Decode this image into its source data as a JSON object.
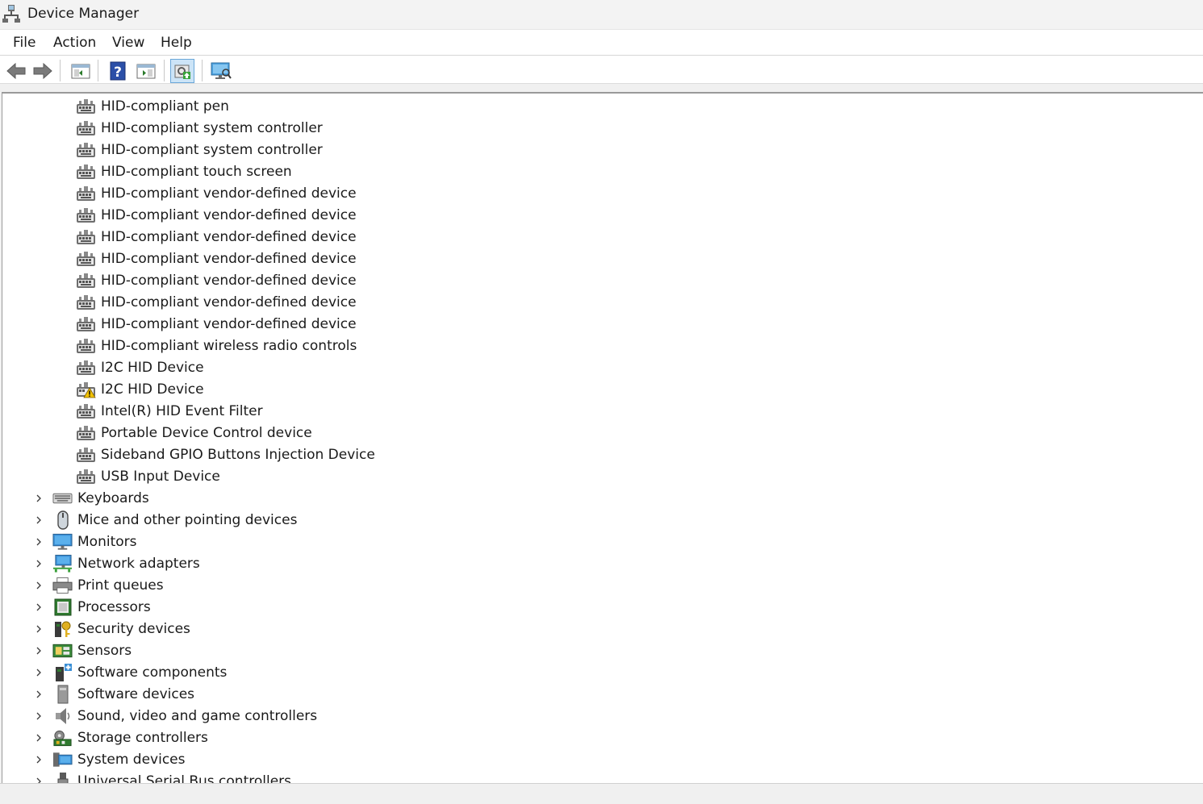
{
  "window": {
    "title": "Device Manager",
    "icon": "device-manager-icon"
  },
  "menu": [
    {
      "label": "File"
    },
    {
      "label": "Action"
    },
    {
      "label": "View"
    },
    {
      "label": "Help"
    }
  ],
  "toolbar": [
    {
      "icon": "back-arrow-icon"
    },
    {
      "icon": "forward-arrow-icon"
    },
    {
      "icon": "show-hide-console-tree-icon"
    },
    {
      "icon": "help-icon"
    },
    {
      "icon": "action-pane-icon"
    },
    {
      "icon": "update-driver-icon"
    },
    {
      "icon": "scan-hardware-changes-icon"
    }
  ],
  "hid_children": [
    {
      "label": "HID-compliant pen",
      "icon": "hid-device-icon"
    },
    {
      "label": "HID-compliant system controller",
      "icon": "hid-device-icon"
    },
    {
      "label": "HID-compliant system controller",
      "icon": "hid-device-icon"
    },
    {
      "label": "HID-compliant touch screen",
      "icon": "hid-device-icon"
    },
    {
      "label": "HID-compliant vendor-defined device",
      "icon": "hid-device-icon"
    },
    {
      "label": "HID-compliant vendor-defined device",
      "icon": "hid-device-icon"
    },
    {
      "label": "HID-compliant vendor-defined device",
      "icon": "hid-device-icon"
    },
    {
      "label": "HID-compliant vendor-defined device",
      "icon": "hid-device-icon"
    },
    {
      "label": "HID-compliant vendor-defined device",
      "icon": "hid-device-icon"
    },
    {
      "label": "HID-compliant vendor-defined device",
      "icon": "hid-device-icon"
    },
    {
      "label": "HID-compliant vendor-defined device",
      "icon": "hid-device-icon"
    },
    {
      "label": "HID-compliant wireless radio controls",
      "icon": "hid-device-icon"
    },
    {
      "label": "I2C HID Device",
      "icon": "hid-device-icon"
    },
    {
      "label": "I2C HID Device",
      "icon": "hid-device-warning-icon"
    },
    {
      "label": "Intel(R) HID Event Filter",
      "icon": "hid-device-icon"
    },
    {
      "label": "Portable Device Control device",
      "icon": "hid-device-icon"
    },
    {
      "label": "Sideband GPIO Buttons Injection Device",
      "icon": "hid-device-icon"
    },
    {
      "label": "USB Input Device",
      "icon": "hid-device-icon"
    }
  ],
  "categories": [
    {
      "label": "Keyboards",
      "icon": "keyboard-icon"
    },
    {
      "label": "Mice and other pointing devices",
      "icon": "mouse-icon"
    },
    {
      "label": "Monitors",
      "icon": "monitor-icon"
    },
    {
      "label": "Network adapters",
      "icon": "network-adapter-icon"
    },
    {
      "label": "Print queues",
      "icon": "printer-icon"
    },
    {
      "label": "Processors",
      "icon": "processor-icon"
    },
    {
      "label": "Security devices",
      "icon": "security-device-icon"
    },
    {
      "label": "Sensors",
      "icon": "sensor-icon"
    },
    {
      "label": "Software components",
      "icon": "software-component-icon"
    },
    {
      "label": "Software devices",
      "icon": "software-device-icon"
    },
    {
      "label": "Sound, video and game controllers",
      "icon": "speaker-icon"
    },
    {
      "label": "Storage controllers",
      "icon": "storage-controller-icon"
    },
    {
      "label": "System devices",
      "icon": "system-device-icon"
    },
    {
      "label": "Universal Serial Bus controllers",
      "icon": "usb-icon"
    }
  ]
}
